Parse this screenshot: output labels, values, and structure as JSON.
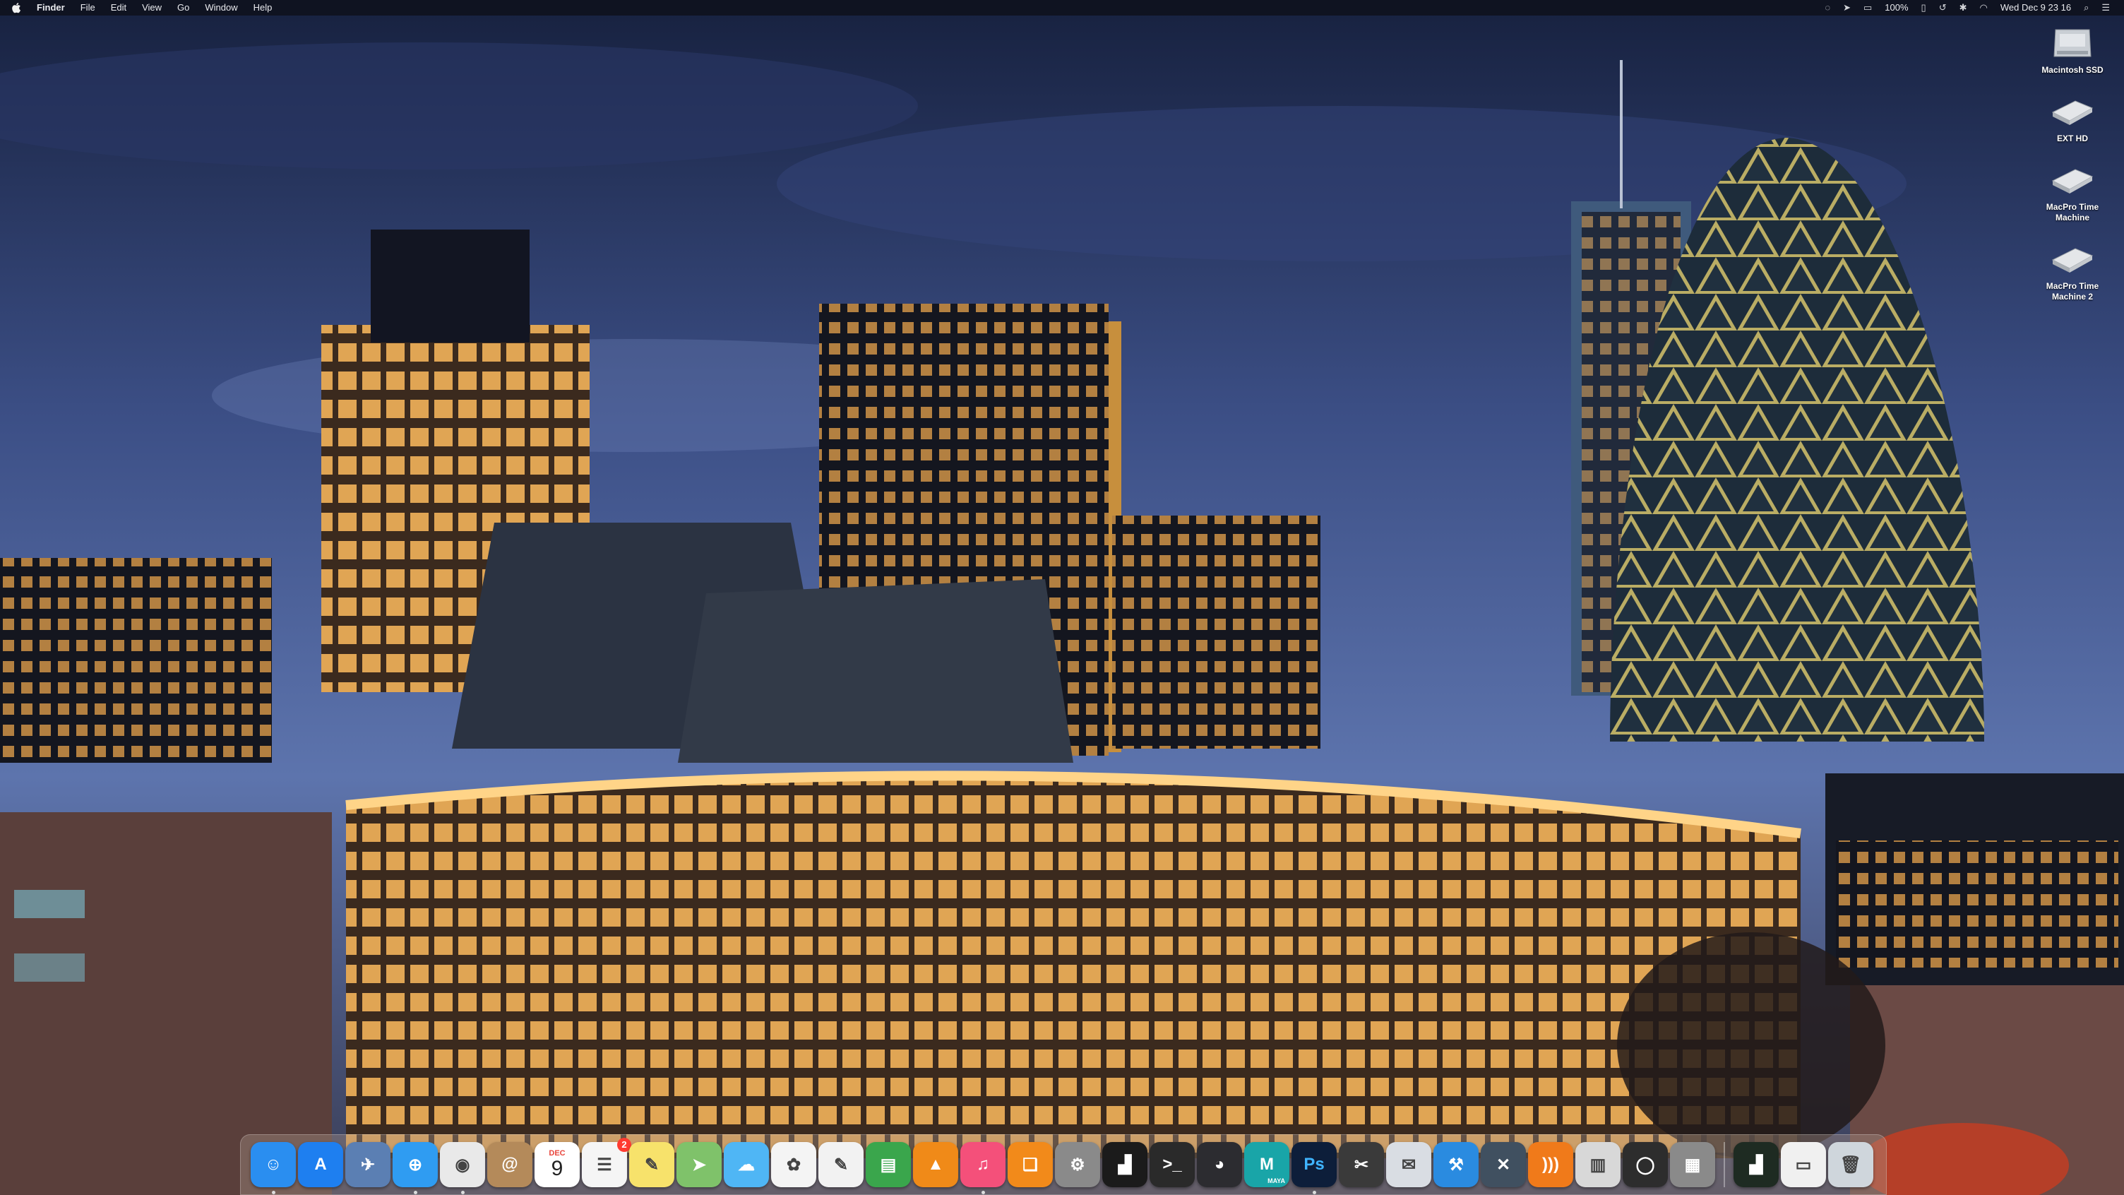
{
  "menubar": {
    "app_name": "Finder",
    "menus": [
      "File",
      "Edit",
      "View",
      "Go",
      "Window",
      "Help"
    ],
    "battery": "100%",
    "clock": "Wed Dec 9  23 16"
  },
  "desktop_icons": [
    {
      "label": "Macintosh SSD",
      "icon": "internal-drive-icon"
    },
    {
      "label": "EXT HD",
      "icon": "external-drive-icon"
    },
    {
      "label": "MacPro Time Machine",
      "icon": "external-drive-icon"
    },
    {
      "label": "MacPro Time Machine 2",
      "icon": "external-drive-icon"
    }
  ],
  "dock": {
    "calendar_month": "DEC",
    "calendar_day": "9",
    "reminders_badge": "2",
    "maya_label": "MAYA",
    "ps_label": "Ps",
    "apps": [
      {
        "name": "finder",
        "color": "#2a8ef0",
        "glyph": "☺",
        "running": true
      },
      {
        "name": "app-store",
        "color": "#1e7ff0",
        "glyph": "A",
        "running": false
      },
      {
        "name": "preview",
        "color": "#5b7fb3",
        "glyph": "✈",
        "running": false
      },
      {
        "name": "safari",
        "color": "#2f9cf2",
        "glyph": "⊕",
        "running": true
      },
      {
        "name": "chrome",
        "color": "#e9e9e9",
        "glyph": "◉",
        "running": true
      },
      {
        "name": "contacts",
        "color": "#b48a5a",
        "glyph": "@",
        "running": false
      },
      {
        "name": "calendar",
        "color": "#ffffff",
        "glyph": "",
        "running": false
      },
      {
        "name": "reminders",
        "color": "#f5f5f5",
        "glyph": "☰",
        "running": false
      },
      {
        "name": "notes",
        "color": "#f7e26b",
        "glyph": "✎",
        "running": false
      },
      {
        "name": "maps",
        "color": "#7fc26a",
        "glyph": "➤",
        "running": false
      },
      {
        "name": "messages",
        "color": "#4fb6f5",
        "glyph": "☁",
        "running": false
      },
      {
        "name": "photos",
        "color": "#f4f4f4",
        "glyph": "✿",
        "running": false
      },
      {
        "name": "textedit",
        "color": "#f2f2f2",
        "glyph": "✎",
        "running": false
      },
      {
        "name": "numbers",
        "color": "#3aa64c",
        "glyph": "▤",
        "running": false
      },
      {
        "name": "vlc",
        "color": "#f08a18",
        "glyph": "▲",
        "running": false
      },
      {
        "name": "itunes",
        "color": "#f4507a",
        "glyph": "♫",
        "running": true
      },
      {
        "name": "ibooks",
        "color": "#f28a1a",
        "glyph": "❑",
        "running": false
      },
      {
        "name": "system-preferences",
        "color": "#8a8a8a",
        "glyph": "⚙",
        "running": false
      },
      {
        "name": "activity-monitor",
        "color": "#1b1b1b",
        "glyph": "▟",
        "running": false
      },
      {
        "name": "terminal",
        "color": "#2a2a2a",
        "glyph": ">_",
        "running": false
      },
      {
        "name": "davinci-resolve",
        "color": "#2c2c30",
        "glyph": "◕",
        "running": false
      },
      {
        "name": "maya",
        "color": "#19a5a8",
        "glyph": "M",
        "running": false
      },
      {
        "name": "photoshop",
        "color": "#0d1e3a",
        "glyph": "",
        "running": true
      },
      {
        "name": "final-cut-pro",
        "color": "#3a3a3a",
        "glyph": "✂",
        "running": false
      },
      {
        "name": "mail",
        "color": "#d9dde3",
        "glyph": "✉",
        "running": false
      },
      {
        "name": "xcode",
        "color": "#2a8be0",
        "glyph": "⚒",
        "running": false
      },
      {
        "name": "instruments",
        "color": "#405060",
        "glyph": "✕",
        "running": false
      },
      {
        "name": "rss-reader",
        "color": "#f07a1a",
        "glyph": ")))",
        "running": false
      },
      {
        "name": "books-library",
        "color": "#d8d8d8",
        "glyph": "▥",
        "running": false
      },
      {
        "name": "quicktime",
        "color": "#2d2d2d",
        "glyph": "◯",
        "running": false
      },
      {
        "name": "archive-utility",
        "color": "#8a8a8a",
        "glyph": "▦",
        "running": false
      }
    ],
    "right_items": [
      {
        "name": "console",
        "color": "#1e2b22",
        "glyph": "▟"
      },
      {
        "name": "document-stack",
        "color": "#f0f0f0",
        "glyph": "▭"
      },
      {
        "name": "trash",
        "color": "#cfd6dc",
        "glyph": "🗑"
      }
    ]
  },
  "colors": {
    "sky_top": "#1d2a52",
    "sky_bottom": "#5a6fa6",
    "menubar": "#0f121e"
  }
}
